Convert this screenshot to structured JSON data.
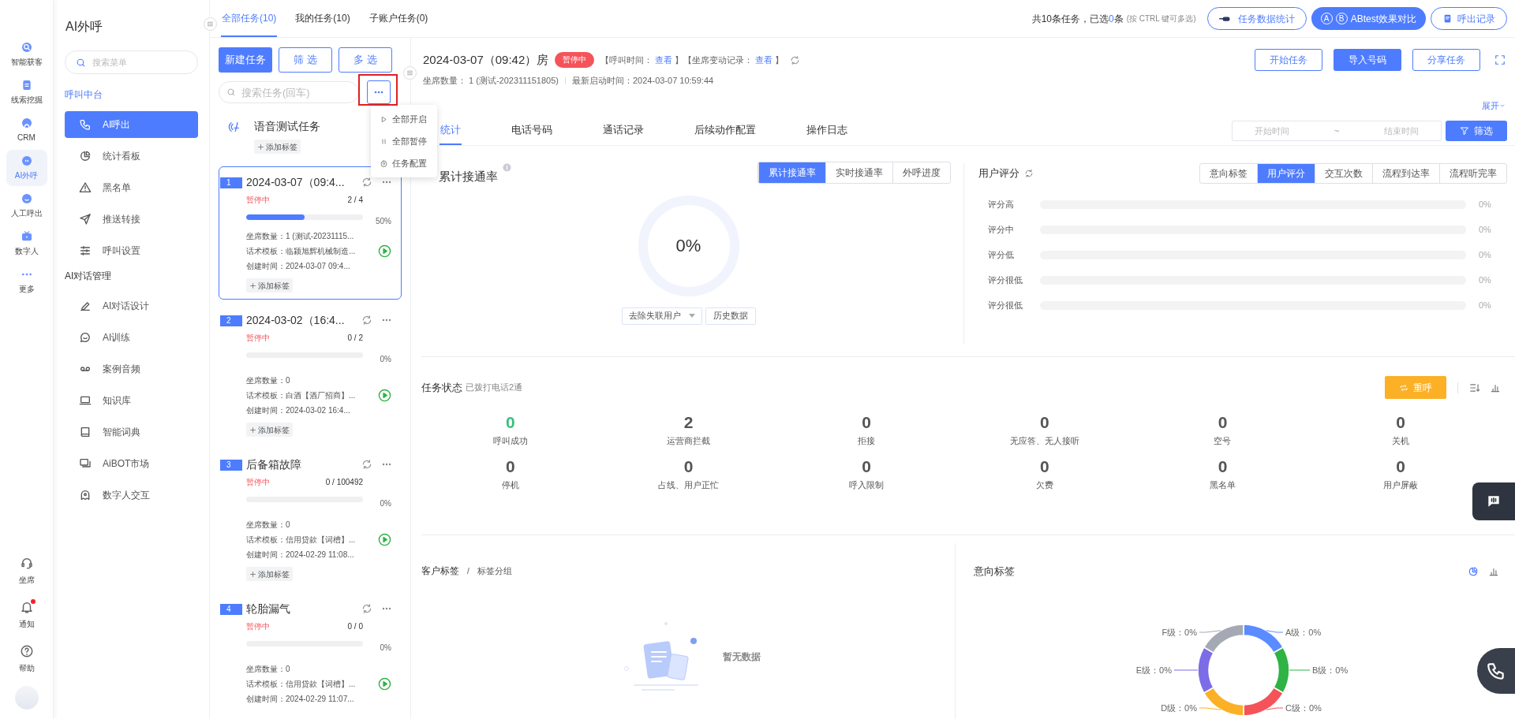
{
  "rail": {
    "items": [
      {
        "label": "智能获客",
        "selected": false
      },
      {
        "label": "线索挖掘",
        "selected": false
      },
      {
        "label": "CRM",
        "selected": false
      },
      {
        "label": "AI外呼",
        "selected": true
      },
      {
        "label": "人工呼出",
        "selected": false
      },
      {
        "label": "数字人",
        "selected": false
      },
      {
        "label": "更多",
        "selected": false
      }
    ],
    "bottom": [
      {
        "label": "坐席",
        "badge": false
      },
      {
        "label": "通知",
        "badge": true
      },
      {
        "label": "帮助",
        "badge": false
      }
    ]
  },
  "menu": {
    "title": "AI外呼",
    "search": {
      "placeholder": "搜索菜单"
    },
    "groups": [
      {
        "title": "呼叫中台",
        "items": [
          {
            "label": "AI呼出",
            "selected": true
          },
          {
            "label": "统计看板",
            "selected": false
          },
          {
            "label": "黑名单",
            "selected": false
          },
          {
            "label": "推送转接",
            "selected": false
          },
          {
            "label": "呼叫设置",
            "selected": false
          }
        ]
      },
      {
        "title": "AI对话管理",
        "items": [
          {
            "label": "AI对话设计",
            "selected": false
          },
          {
            "label": "AI训练",
            "selected": false
          },
          {
            "label": "案例音频",
            "selected": false
          },
          {
            "label": "知识库",
            "selected": false
          },
          {
            "label": "智能词典",
            "selected": false
          },
          {
            "label": "AiBOT市场",
            "selected": false
          },
          {
            "label": "数字人交互",
            "selected": false
          }
        ]
      }
    ]
  },
  "task_tabs": [
    {
      "label": "全部任务(10)",
      "selected": true
    },
    {
      "label": "我的任务(10)",
      "selected": false
    },
    {
      "label": "子账户任务(0)",
      "selected": false
    }
  ],
  "top_summary": {
    "before": "共10条任务，已选",
    "count": "0",
    "after": "条",
    "hint": "(按 CTRL 键可多选)"
  },
  "top_buttons": [
    {
      "label": "任务数据统计",
      "kind": "stats",
      "primary": false
    },
    {
      "label": "ABtest效果对比",
      "kind": "ab",
      "primary": true,
      "letters": [
        "A",
        "B"
      ]
    },
    {
      "label": "呼出记录",
      "kind": "record",
      "primary": false
    }
  ],
  "task_actions": [
    {
      "label": "新建任务",
      "primary": true
    },
    {
      "label": "筛 选",
      "primary": false
    },
    {
      "label": "多 选",
      "primary": false
    }
  ],
  "task_search": {
    "placeholder": "搜索任务(回车)"
  },
  "more_menu": [
    {
      "label": "全部开启",
      "kind": "play"
    },
    {
      "label": "全部暂停",
      "kind": "pause"
    },
    {
      "label": "任务配置",
      "kind": "gear"
    }
  ],
  "voice_task": {
    "name": "语音测试任务",
    "add_tag": "添加标签"
  },
  "tasks": [
    {
      "index": "1",
      "title": "2024-03-07（09:4...",
      "selected": true,
      "status": "暂停中",
      "count": "2 / 4",
      "level": 0.5,
      "percent": "50%",
      "fields": [
        "坐席数量：1 (测试-20231115...",
        "话术模板：临颍旭辉机械制造...",
        "创建时间：2024-03-07 09:4..."
      ],
      "add_tag": "添加标签"
    },
    {
      "index": "2",
      "title": "2024-03-02（16:4...",
      "selected": false,
      "status": "暂停中",
      "count": "0 / 2",
      "level": 0,
      "percent": "0%",
      "fields": [
        "坐席数量：0",
        "话术模板：白酒【酒厂招商】...",
        "创建时间：2024-03-02 16:4..."
      ],
      "add_tag": "添加标签"
    },
    {
      "index": "3",
      "title": "后备箱故障",
      "selected": false,
      "status": "暂停中",
      "count": "0 / 100492",
      "level": 0,
      "percent": "0%",
      "fields": [
        "坐席数量：0",
        "话术模板：信用贷款【词槽】...",
        "创建时间：2024-02-29 11:08..."
      ],
      "add_tag": "添加标签"
    },
    {
      "index": "4",
      "title": "轮胎漏气",
      "selected": false,
      "status": "暂停中",
      "count": "0 / 0",
      "level": 0,
      "percent": "0%",
      "fields": [
        "坐席数量：0",
        "话术模板：信用贷款【词槽】...",
        "创建时间：2024-02-29 11:07..."
      ]
    }
  ],
  "header": {
    "title": "2024-03-07（09:42）房",
    "status": "暂停中",
    "records": [
      {
        "text": "【呼叫时间：",
        "link": false
      },
      {
        "text": "查看",
        "link": true
      },
      {
        "text": "】【坐席变动记录：",
        "link": false
      },
      {
        "text": "查看",
        "link": true
      },
      {
        "text": "】",
        "link": false
      }
    ],
    "meta": [
      "坐席数量： 1 (测试-202311151805)",
      "最新启动时间：2024-03-07 10:59:44"
    ],
    "buttons": [
      {
        "label": "开始任务",
        "primary": false
      },
      {
        "label": "导入号码",
        "primary": true
      },
      {
        "label": "分享任务",
        "primary": false
      }
    ],
    "expand": "展开"
  },
  "tabs": [
    {
      "label": "统计",
      "selected": true
    },
    {
      "label": "电话号码",
      "selected": false
    },
    {
      "label": "通话记录",
      "selected": false
    },
    {
      "label": "后续动作配置",
      "selected": false
    },
    {
      "label": "操作日志",
      "selected": false
    }
  ],
  "date_range": {
    "start_placeholder": "开始时间",
    "separator": "~",
    "end_placeholder": "结束时间"
  },
  "filter_button": "筛选",
  "connect": {
    "title": "累计接通率",
    "modes": [
      {
        "label": "累计接通率",
        "selected": true
      },
      {
        "label": "实时接通率",
        "selected": false
      },
      {
        "label": "外呼进度",
        "selected": false
      }
    ],
    "value": "0%",
    "select": "去除失联用户",
    "history_button": "历史数据"
  },
  "score": {
    "title": "用户评分",
    "modes": [
      {
        "label": "意向标签",
        "selected": false
      },
      {
        "label": "用户评分",
        "selected": true
      },
      {
        "label": "交互次数",
        "selected": false
      },
      {
        "label": "流程到达率",
        "selected": false
      },
      {
        "label": "流程听完率",
        "selected": false
      }
    ],
    "rows": [
      {
        "label": "评分高",
        "level": 0,
        "reading": "0%"
      },
      {
        "label": "评分中",
        "level": 0,
        "reading": "0%"
      },
      {
        "label": "评分低",
        "level": 0,
        "reading": "0%"
      },
      {
        "label": "评分很低",
        "level": 0,
        "reading": "0%"
      },
      {
        "label": "评分很低",
        "level": 0,
        "reading": "0%"
      }
    ]
  },
  "task_status": {
    "title": "任务状态",
    "subtitle": "已拨打电话2通",
    "recall_button": "重呼",
    "stats": [
      {
        "value": "0",
        "label": "呼叫成功",
        "color": "#3cbf7e"
      },
      {
        "value": "2",
        "label": "运营商拦截",
        "color": "#555555"
      },
      {
        "value": "0",
        "label": "拒接",
        "color": "#555555"
      },
      {
        "value": "0",
        "label": "无应答、无人接听",
        "color": "#555555"
      },
      {
        "value": "0",
        "label": "空号",
        "color": "#555555"
      },
      {
        "value": "0",
        "label": "关机",
        "color": "#555555"
      },
      {
        "value": "0",
        "label": "停机",
        "color": "#555555"
      },
      {
        "value": "0",
        "label": "占线、用户正忙",
        "color": "#555555"
      },
      {
        "value": "0",
        "label": "呼入限制",
        "color": "#555555"
      },
      {
        "value": "0",
        "label": "欠费",
        "color": "#555555"
      },
      {
        "value": "0",
        "label": "黑名单",
        "color": "#555555"
      },
      {
        "value": "0",
        "label": "用户屏蔽",
        "color": "#555555"
      }
    ]
  },
  "customer_tags": {
    "title": "客户标签",
    "separator": "/",
    "subtitle": "标签分组",
    "empty": "暂无数据"
  },
  "intent_tags": {
    "title": "意向标签",
    "labels": [
      {
        "text": "A级：0%",
        "color": "#5b8cff"
      },
      {
        "text": "B级：0%",
        "color": "#2fb344"
      },
      {
        "text": "C级：0%",
        "color": "#f5535a"
      },
      {
        "text": "D级：0%",
        "color": "#fbb026"
      },
      {
        "text": "E级：0%",
        "color": "#7c6ce8"
      },
      {
        "text": "F级：0%",
        "color": "#a5a9b4"
      }
    ]
  }
}
